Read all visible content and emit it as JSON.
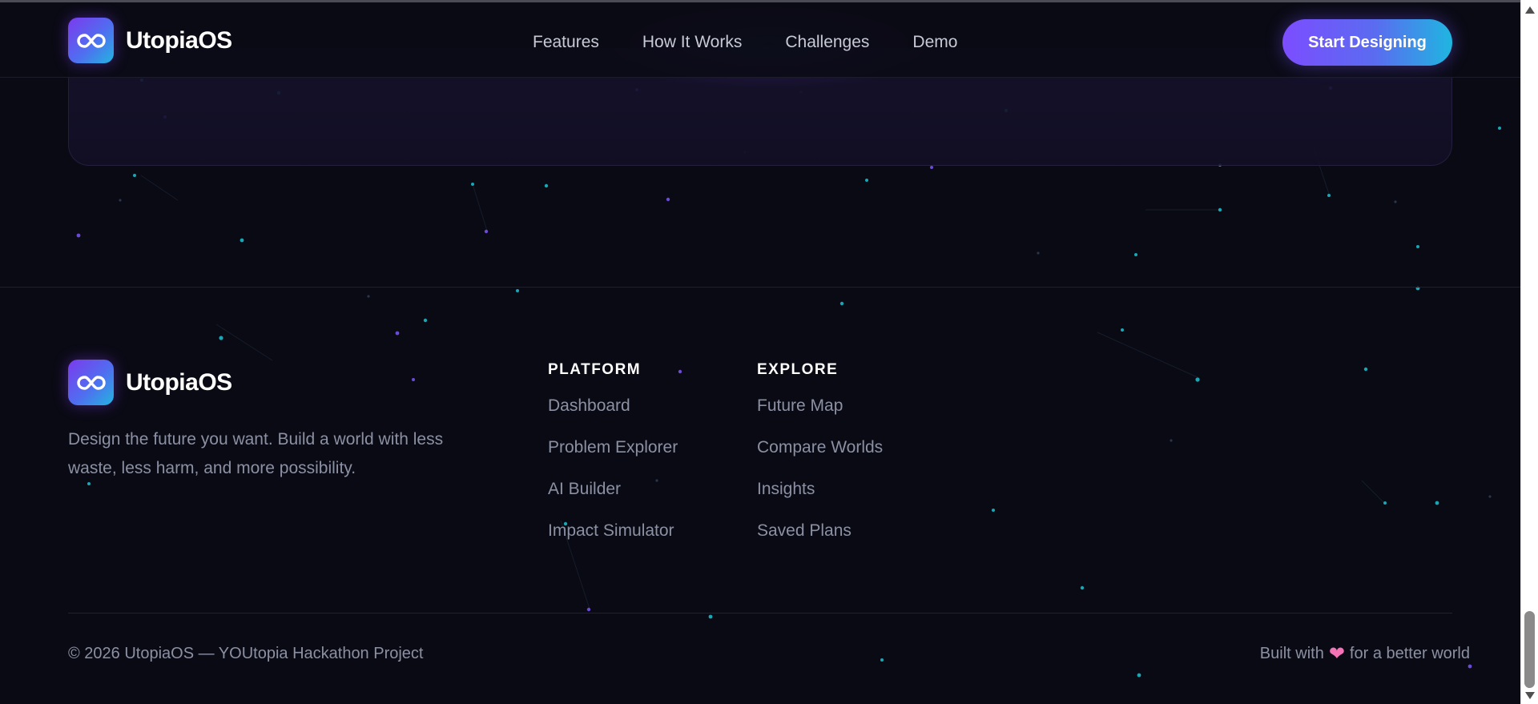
{
  "header": {
    "brand": "UtopiaOS",
    "logo_icon": "infinity-icon",
    "nav": [
      "Features",
      "How It Works",
      "Challenges",
      "Demo"
    ],
    "cta_label": "Start Designing"
  },
  "footer": {
    "brand": "UtopiaOS",
    "logo_icon": "infinity-icon",
    "tagline": "Design the future you want. Build a world with less waste, less harm, and more possibility.",
    "columns": [
      {
        "title": "PLATFORM",
        "links": [
          "Dashboard",
          "Problem Explorer",
          "AI Builder",
          "Impact Simulator"
        ]
      },
      {
        "title": "EXPLORE",
        "links": [
          "Future Map",
          "Compare Worlds",
          "Insights",
          "Saved Plans"
        ]
      }
    ],
    "copyright": "© 2026 UtopiaOS — YOUtopia Hackathon Project",
    "built_prefix": "Built with",
    "built_icon": "heart-icon",
    "built_suffix": "for a better world"
  },
  "colors": {
    "background": "#0a0a14",
    "accent_purple": "#7c4dff",
    "accent_cyan": "#1fb6e0",
    "heart": "#f472b6",
    "muted_text": "#8b90a3"
  }
}
